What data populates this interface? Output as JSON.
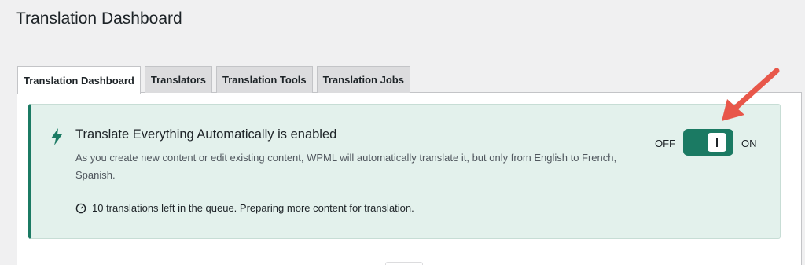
{
  "page": {
    "title": "Translation Dashboard"
  },
  "tabs": [
    {
      "label": "Translation Dashboard",
      "active": true
    },
    {
      "label": "Translators",
      "active": false
    },
    {
      "label": "Translation Tools",
      "active": false
    },
    {
      "label": "Translation Jobs",
      "active": false
    }
  ],
  "notice": {
    "icon": "bolt-icon",
    "heading": "Translate Everything Automatically is enabled",
    "description": "As you create new content or edit existing content, WPML will automatically translate it, but only from English to French, Spanish.",
    "queue_icon": "clock-icon",
    "queue_text": "10 translations left in the queue. Preparing more content for translation.",
    "toggle": {
      "off_label": "OFF",
      "on_label": "ON",
      "state": "on"
    }
  },
  "colors": {
    "accent": "#1b7a63",
    "notice_bg": "#e3f1ec",
    "arrow": "#e8574a"
  }
}
